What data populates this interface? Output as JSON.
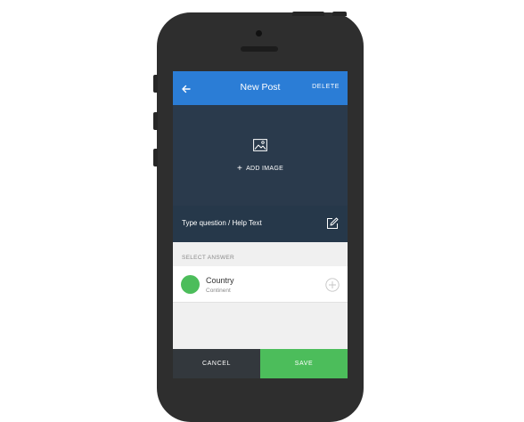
{
  "header": {
    "title": "New Post",
    "delete_label": "DELETE",
    "back_icon": "arrow-left-icon"
  },
  "image_area": {
    "icon": "image-icon",
    "add_label": "ADD IMAGE",
    "plus_glyph": "+"
  },
  "question": {
    "placeholder": "Type question / Help Text",
    "icon": "edit-icon"
  },
  "answers": {
    "section_label": "SELECT ANSWER",
    "items": [
      {
        "title": "Country",
        "subtitle": "Continent",
        "color": "#4cbd5b"
      }
    ]
  },
  "footer": {
    "cancel_label": "CANCEL",
    "save_label": "SAVE"
  },
  "colors": {
    "accent_blue": "#2b7dd6",
    "dark_panel": "#2a3a4c",
    "save_green": "#4cbd5b",
    "cancel_dark": "#33383d"
  }
}
